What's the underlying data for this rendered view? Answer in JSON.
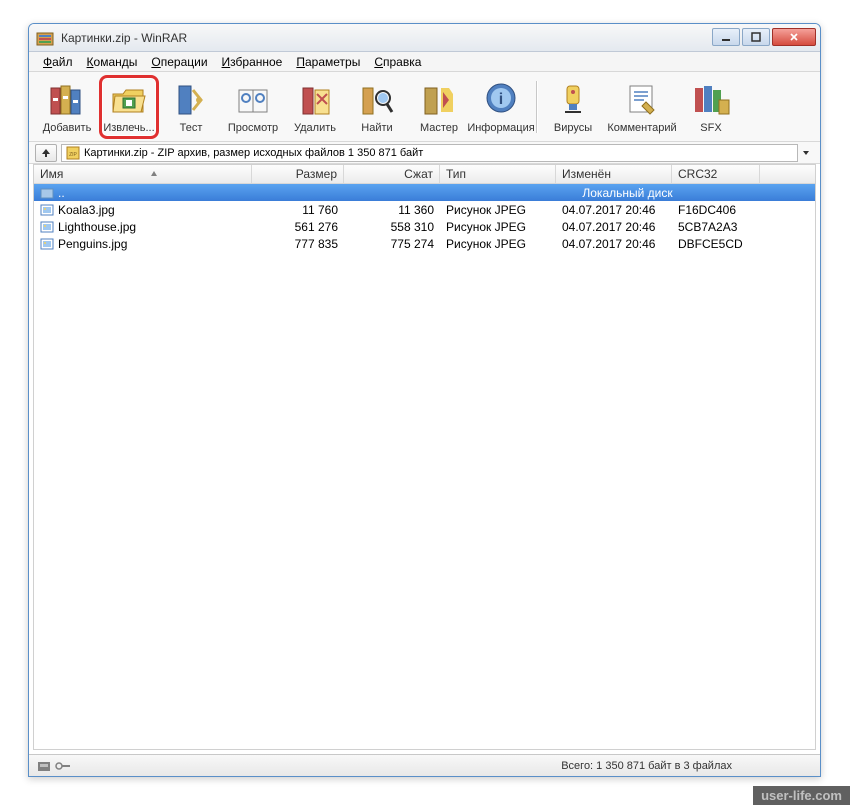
{
  "titlebar": {
    "text": "Картинки.zip - WinRAR"
  },
  "menu": {
    "items": [
      {
        "key": "Ф",
        "label": "айл"
      },
      {
        "key": "К",
        "label": "оманды"
      },
      {
        "key": "О",
        "label": "перации"
      },
      {
        "key": "И",
        "label": "збранное"
      },
      {
        "key": "П",
        "label": "араметры"
      },
      {
        "key": "С",
        "label": "правка"
      }
    ]
  },
  "toolbar": {
    "add": "Добавить",
    "extract": "Извлечь...",
    "test": "Тест",
    "view": "Просмотр",
    "delete": "Удалить",
    "find": "Найти",
    "wizard": "Мастер",
    "info": "Информация",
    "virus": "Вирусы",
    "comment": "Комментарий",
    "sfx": "SFX"
  },
  "address": {
    "text": "Картинки.zip - ZIP архив, размер исходных файлов 1 350 871 байт",
    "icon_label": "ZIP"
  },
  "columns": {
    "name": "Имя",
    "size": "Размер",
    "packed": "Сжат",
    "type": "Тип",
    "modified": "Изменён",
    "crc": "CRC32"
  },
  "parent_row": {
    "dots": "..",
    "type": "Локальный диск"
  },
  "files": [
    {
      "name": "Koala3.jpg",
      "size": "11 760",
      "packed": "11 360",
      "type": "Рисунок JPEG",
      "mod": "04.07.2017 20:46",
      "crc": "F16DC406"
    },
    {
      "name": "Lighthouse.jpg",
      "size": "561 276",
      "packed": "558 310",
      "type": "Рисунок JPEG",
      "mod": "04.07.2017 20:46",
      "crc": "5CB7A2A3"
    },
    {
      "name": "Penguins.jpg",
      "size": "777 835",
      "packed": "775 274",
      "type": "Рисунок JPEG",
      "mod": "04.07.2017 20:46",
      "crc": "DBFCE5CD"
    }
  ],
  "status": {
    "text": "Всего: 1 350 871 байт в 3 файлах"
  },
  "watermark": "user-life.com"
}
